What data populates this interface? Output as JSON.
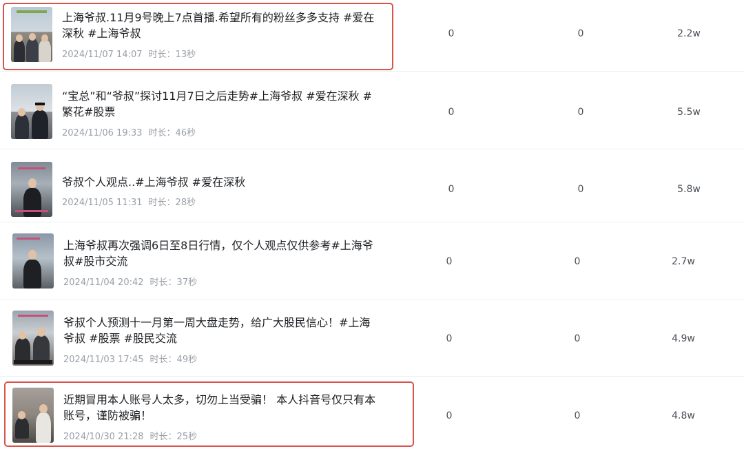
{
  "videos": [
    {
      "title": "上海爷叔.11月9号晚上7点首播.希望所有的粉丝多多支持 #爱在深秋 #上海爷叔",
      "date": "2024/11/07 14:07",
      "duration_label": "时长：",
      "duration": "13秒",
      "stat1": "0",
      "stat2": "0",
      "views": "2.2w",
      "highlighted": true
    },
    {
      "title": "“宝总”和“爷叔”探讨11月7日之后走势#上海爷叔 #爱在深秋 #繁花#股票",
      "date": "2024/11/06 19:33",
      "duration_label": "时长：",
      "duration": "46秒",
      "stat1": "0",
      "stat2": "0",
      "views": "5.5w",
      "highlighted": false
    },
    {
      "title": "爷叔个人观点..#上海爷叔 #爱在深秋",
      "date": "2024/11/05 11:31",
      "duration_label": "时长：",
      "duration": "28秒",
      "stat1": "0",
      "stat2": "0",
      "views": "5.8w",
      "highlighted": false
    },
    {
      "title": "上海爷叔再次强调6日至8日行情，仅个人观点仅供参考#上海爷叔#股市交流",
      "date": "2024/11/04 20:42",
      "duration_label": "时长：",
      "duration": "37秒",
      "stat1": "0",
      "stat2": "0",
      "views": "2.7w",
      "highlighted": false
    },
    {
      "title": "爷叔个人预测十一月第一周大盘走势，给广大股民信心！#上海爷叔 #股票 #股民交流",
      "date": "2024/11/03 17:45",
      "duration_label": "时长：",
      "duration": "49秒",
      "stat1": "0",
      "stat2": "0",
      "views": "4.9w",
      "highlighted": false
    },
    {
      "title": "近期冒用本人账号人太多，切勿上当受骗！ 本人抖音号仅只有本账号，谨防被骗！",
      "date": "2024/10/30 21:28",
      "duration_label": "时长：",
      "duration": "25秒",
      "stat1": "0",
      "stat2": "0",
      "views": "4.8w",
      "highlighted": true
    }
  ],
  "colors": {
    "highlight_border": "#d9534a",
    "title": "#1c1f23",
    "meta": "#9aa0a8",
    "stat": "#4a4f57"
  }
}
